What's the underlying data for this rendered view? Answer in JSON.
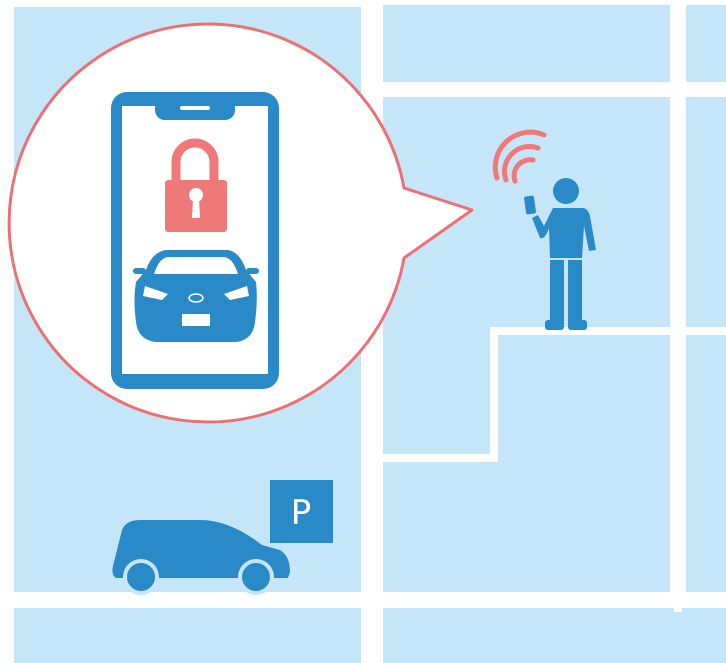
{
  "colors": {
    "background": "#ffffff",
    "map_block": "#c5e6f8",
    "accent_blue": "#2a8ac8",
    "lock_red": "#ef7878",
    "bubble_outline": "#ec6f73",
    "car_body": "#2a8ac8"
  },
  "parking_sign": {
    "label": "P",
    "icon": "parking-sign-icon"
  },
  "phone": {
    "icon": "smartphone-icon",
    "lock_icon": "lock-icon",
    "car_icon": "car-front-icon"
  },
  "person": {
    "icon": "person-with-phone-icon",
    "signal_icon": "wireless-signal-icon"
  },
  "parked_car": {
    "icon": "car-side-icon"
  }
}
